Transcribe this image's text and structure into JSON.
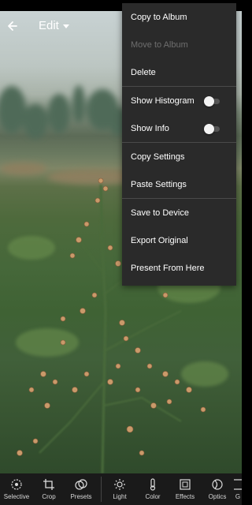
{
  "header": {
    "title": "Edit"
  },
  "menu": {
    "items": [
      {
        "label": "Copy to Album"
      },
      {
        "label": "Move to Album"
      },
      {
        "label": "Delete"
      },
      {
        "label": "Show Histogram"
      },
      {
        "label": "Show Info"
      },
      {
        "label": "Copy Settings"
      },
      {
        "label": "Paste Settings"
      },
      {
        "label": "Save to Device"
      },
      {
        "label": "Export Original"
      },
      {
        "label": "Present From Here"
      }
    ]
  },
  "toolbar": {
    "tools": [
      {
        "label": "Selective"
      },
      {
        "label": "Crop"
      },
      {
        "label": "Presets"
      },
      {
        "label": "Light"
      },
      {
        "label": "Color"
      },
      {
        "label": "Effects"
      },
      {
        "label": "Optics"
      },
      {
        "label": "G"
      }
    ]
  },
  "colors": {
    "menu_background": "#2a2a2a",
    "menu_text": "#ffffff",
    "disabled_text": "#6e6e6e",
    "toolbar_background": "#1a1a1a"
  }
}
